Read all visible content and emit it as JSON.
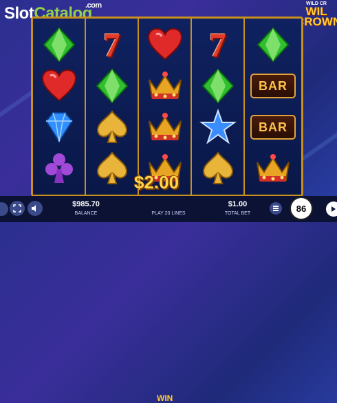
{
  "logo": {
    "part1": "Slot",
    "part2": "Catalog",
    "suffix": ".com"
  },
  "game_title": {
    "small": "WILD CR",
    "big1": "WIL",
    "big2": "CROWN"
  },
  "reels": [
    [
      "green-diamond",
      "red-heart",
      "blue-gem",
      "purple-club"
    ],
    [
      "red-seven",
      "green-diamond",
      "gold-spade",
      "gold-spade"
    ],
    [
      "red-heart",
      "crown",
      "crown",
      "crown"
    ],
    [
      "red-seven",
      "green-diamond",
      "blue-star",
      "gold-spade"
    ],
    [
      "green-diamond",
      "bar",
      "bar",
      "crown"
    ]
  ],
  "bar_label": "BAR",
  "seven_label": "7",
  "win_display": "$2.00",
  "bottom": {
    "balance_value": "$985.70",
    "balance_label": "BALANCE",
    "win_label": "WIN",
    "lines_label": "PLAY 20 LINES",
    "bet_value": "$1.00",
    "bet_label": "TOTAL BET",
    "spin_count": "86"
  },
  "colors": {
    "frame": "#c9901d",
    "win": "#ffd34a",
    "accent_green": "#8fd14f"
  }
}
